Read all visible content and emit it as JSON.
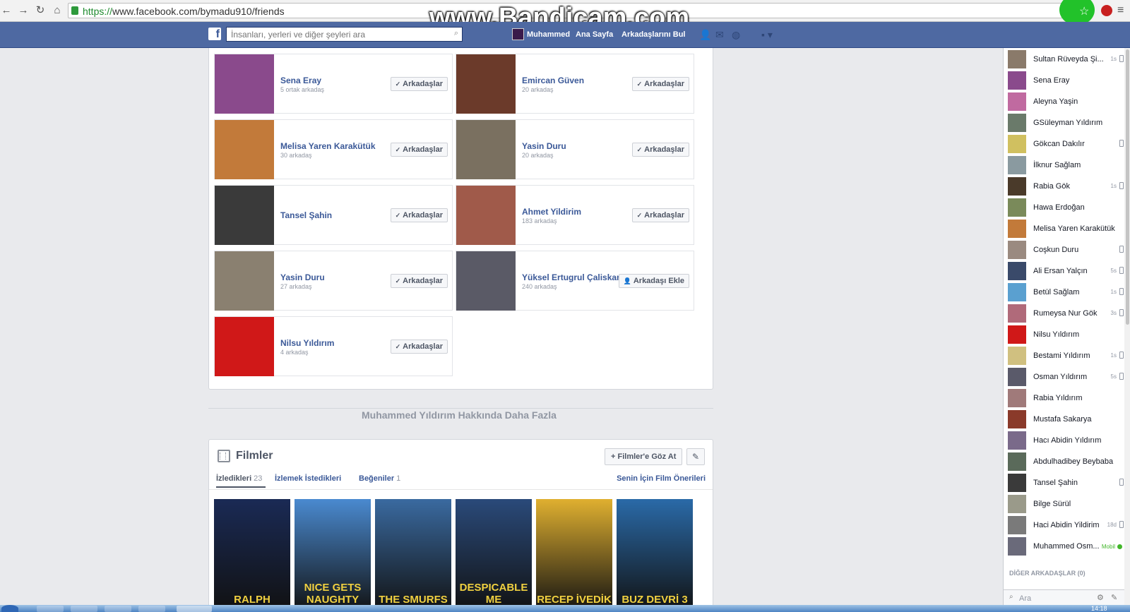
{
  "browser": {
    "url_proto": "https://",
    "url_rest": "www.facebook.com/bymadu910/friends",
    "watermark": "www.Bandicam.com",
    "star_icon": "star-icon",
    "accent": "#22c22a"
  },
  "fb_nav": {
    "search_placeholder": "İnsanları, yerleri ve diğer şeyleri ara",
    "profile_name": "Muhammed",
    "home": "Ana Sayfa",
    "find_friends": "Arkadaşlarını Bul",
    "bar_color": "#4e69a2"
  },
  "friends": [
    {
      "name": "Sena Eray",
      "sub": "5 ortak arkadaş",
      "button": "Arkadaşlar",
      "img": "#8a4a8c"
    },
    {
      "name": "Emircan Güven",
      "sub": "20 arkadaş",
      "button": "Arkadaşlar",
      "img": "#6b3a2a"
    },
    {
      "name": "Melisa Yaren Karakütük",
      "sub": "30 arkadaş",
      "button": "Arkadaşlar",
      "img": "#c27a3a"
    },
    {
      "name": "Yasin Duru",
      "sub": "20 arkadaş",
      "button": "Arkadaşlar",
      "img": "#7a7060"
    },
    {
      "name": "Tansel Şahin",
      "sub": "",
      "button": "Arkadaşlar",
      "img": "#3a3a3a"
    },
    {
      "name": "Ahmet Yildirim",
      "sub": "183 arkadaş",
      "button": "Arkadaşlar",
      "img": "#a05a4a"
    },
    {
      "name": "Yasin Duru",
      "sub": "27 arkadaş",
      "button": "Arkadaşlar",
      "img": "#8a8070"
    },
    {
      "name": "Yüksel Ertugrul Çaliskan",
      "sub": "240 arkadaş",
      "button": "Arkadaşı Ekle",
      "img": "#5a5a66"
    },
    {
      "name": "Nilsu Yıldırım",
      "sub": "4 arkadaş",
      "button": "Arkadaşlar",
      "img": "#d01818"
    }
  ],
  "more_about": "Muhammed Yıldırım Hakkında Daha Fazla",
  "films": {
    "title": "Filmler",
    "browse_button": "Filmler'e Göz At",
    "tabs": [
      {
        "label": "İzledikleri",
        "count": "23"
      },
      {
        "label": "İzlemek İstedikleri",
        "count": ""
      },
      {
        "label": "Beğeniler",
        "count": "1"
      }
    ],
    "recommendations": "Senin İçin Film Önerileri",
    "posters": [
      {
        "title": "RALPH",
        "color": "#1a2a55"
      },
      {
        "title": "NICE GETS NAUGHTY",
        "color": "#4a8ad0"
      },
      {
        "title": "THE SMURFS",
        "color": "#3a6aa0"
      },
      {
        "title": "DESPICABLE ME",
        "color": "#2a4a7a"
      },
      {
        "title": "RECEP İVEDİK",
        "color": "#e0b030"
      },
      {
        "title": "BUZ DEVRİ 3",
        "color": "#2a6aa8"
      }
    ]
  },
  "chat": {
    "contacts": [
      {
        "name": "Sultan Rüveyda Şi...",
        "time": "1s",
        "status": "icon",
        "color": "#8a7a6a"
      },
      {
        "name": "Sena Eray",
        "time": "",
        "status": "",
        "color": "#8a4a8c"
      },
      {
        "name": "Aleyna Yaşin",
        "time": "",
        "status": "",
        "color": "#c06aa0"
      },
      {
        "name": "GSüleyman Yıldırım",
        "time": "",
        "status": "",
        "color": "#6a7a6a"
      },
      {
        "name": "Gökcan Dakılır",
        "time": "",
        "status": "icon",
        "color": "#d0c060"
      },
      {
        "name": "İlknur Sağlam",
        "time": "",
        "status": "",
        "color": "#8a9aa0"
      },
      {
        "name": "Rabia Gök",
        "time": "1s",
        "status": "icon",
        "color": "#4a3a2a"
      },
      {
        "name": "Hawa Erdoğan",
        "time": "",
        "status": "",
        "color": "#7a8a5a"
      },
      {
        "name": "Melisa Yaren Karakütük",
        "time": "",
        "status": "",
        "color": "#c27a3a"
      },
      {
        "name": "Coşkun Duru",
        "time": "",
        "status": "icon",
        "color": "#9a8a80"
      },
      {
        "name": "Ali Ersan Yalçın",
        "time": "5s",
        "status": "icon",
        "color": "#3a4a6a"
      },
      {
        "name": "Betül Sağlam",
        "time": "1s",
        "status": "icon",
        "color": "#5aa0d0"
      },
      {
        "name": "Rumeysa Nur Gök",
        "time": "3s",
        "status": "icon",
        "color": "#b06a7a"
      },
      {
        "name": "Nilsu Yıldırım",
        "time": "",
        "status": "",
        "color": "#d01818"
      },
      {
        "name": "Bestami Yıldırım",
        "time": "1s",
        "status": "icon",
        "color": "#d0c080"
      },
      {
        "name": "Osman Yıldırım",
        "time": "5s",
        "status": "icon",
        "color": "#5a5a6a"
      },
      {
        "name": "Rabia Yıldırım",
        "time": "",
        "status": "",
        "color": "#a07a7a"
      },
      {
        "name": "Mustafa Sakarya",
        "time": "",
        "status": "",
        "color": "#8a3a2a"
      },
      {
        "name": "Hacı Abidin Yıldırım",
        "time": "",
        "status": "",
        "color": "#7a6a8a"
      },
      {
        "name": "Abdulhadibey Beybaba",
        "time": "",
        "status": "",
        "color": "#5a6a5a"
      },
      {
        "name": "Tansel Şahin",
        "time": "",
        "status": "icon",
        "color": "#3a3a3a"
      },
      {
        "name": "Bilge Sürül",
        "time": "",
        "status": "",
        "color": "#9a9a8a"
      },
      {
        "name": "Haci Abidin Yildirim",
        "time": "18d",
        "status": "icon",
        "color": "#7a7a7a"
      },
      {
        "name": "Muhammed Osm...",
        "time": "",
        "status": "mobile",
        "color": "#6a6a7a"
      }
    ],
    "other_friends": "DİĞER ARKADAŞLAR (0)",
    "search_placeholder": "Ara",
    "mobile_label": "Mobil"
  },
  "taskbar": {
    "clock": "14:18"
  }
}
